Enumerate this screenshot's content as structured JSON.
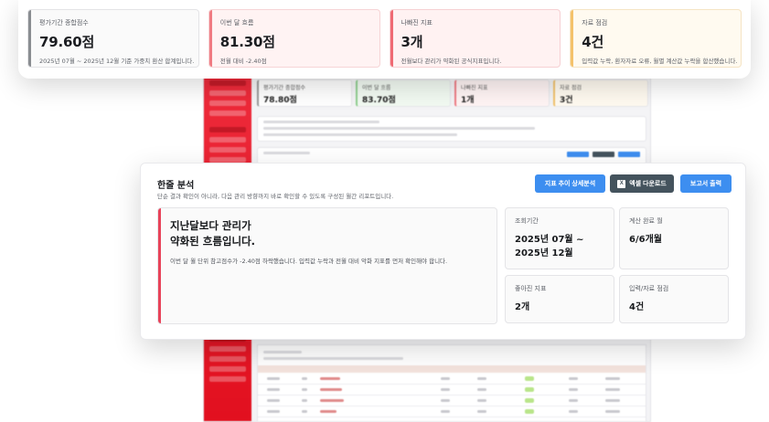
{
  "kpis": [
    {
      "label": "평가기간 종합점수",
      "value": "79.60점",
      "sub": "2025년 07월 ~ 2025년 12월 기준 가중치 환산 합계입니다.",
      "tone": "gray"
    },
    {
      "label": "이번 달 흐름",
      "value": "81.30점",
      "sub": "전월 대비 -2.40점",
      "tone": "red"
    },
    {
      "label": "나빠진 지표",
      "value": "3개",
      "sub": "전월보다 관리가 약화된 공식지표입니다.",
      "tone": "pink"
    },
    {
      "label": "자료 점검",
      "value": "4건",
      "sub": "입력값 누락, 환자자료 오류, 월별 계산값 누락을 합산했습니다.",
      "tone": "yellow"
    }
  ],
  "summary": {
    "title": "한줄 분석",
    "subtitle": "단순 결과 확인이 아니라, 다음 관리 방향까지 바로 확인할 수 있도록 구성된 월간 리포트입니다.",
    "buttons": {
      "trend": "지표 추이 상세분석",
      "excel": "엑셀 다운로드",
      "print": "보고서 출력",
      "excel_icon": "X"
    },
    "headline_line1": "지난달보다 관리가",
    "headline_line2": "약화된 흐름입니다.",
    "description": "이번 달 월 단위 참고점수가 -2.40점 하락했습니다. 입력값 누락과 전월 대비 악화 지표를 먼저 확인해야 합니다.",
    "stats": {
      "period_label": "조회기간",
      "period_value_line1": "2025년 07월 ~",
      "period_value_line2": "2025년 12월",
      "calc_label": "계산 완료 월",
      "calc_value": "6/6개월",
      "improved_label": "좋아진 지표",
      "improved_value": "2개",
      "check_label": "입력/자료 점검",
      "check_value": "4건"
    }
  },
  "colors": {
    "accent_red": "#e8435a",
    "button_blue": "#3d8ef0",
    "button_dark": "#44535d",
    "sidebar_red": "#ee2b3b"
  }
}
